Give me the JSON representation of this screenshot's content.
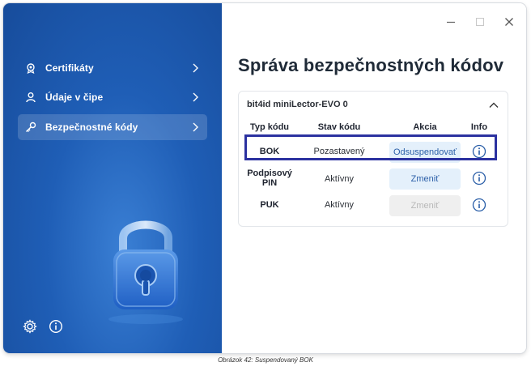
{
  "sidebar": {
    "items": [
      {
        "label": "Certifikáty",
        "icon": "certificate-icon"
      },
      {
        "label": "Údaje v čipe",
        "icon": "user-icon"
      },
      {
        "label": "Bezpečnostné kódy",
        "icon": "key-icon",
        "active": true
      }
    ],
    "bottom_icons": [
      "gear-icon",
      "info-icon"
    ]
  },
  "window_controls": [
    "minimize",
    "maximize",
    "close"
  ],
  "main": {
    "title": "Správa bezpečnostných kódov",
    "panel": {
      "device": "bit4id miniLector-EVO 0",
      "columns": [
        "Typ kódu",
        "Stav kódu",
        "Akcia",
        "Info"
      ],
      "rows": [
        {
          "type": "BOK",
          "status": "Pozastavený",
          "action": "Odsuspendovať",
          "action_enabled": true
        },
        {
          "type": "Podpisový PIN",
          "status": "Aktívny",
          "action": "Zmeniť",
          "action_enabled": true
        },
        {
          "type": "PUK",
          "status": "Aktívny",
          "action": "Zmeniť",
          "action_enabled": false
        }
      ]
    }
  },
  "caption": "Obrázok 42: Suspendovaný BOK",
  "colors": {
    "sidebar_blue": "#1f5eb6",
    "highlight_border": "#2b31a0",
    "button_bg": "#e4f0fb",
    "button_text": "#2b5fa8"
  }
}
